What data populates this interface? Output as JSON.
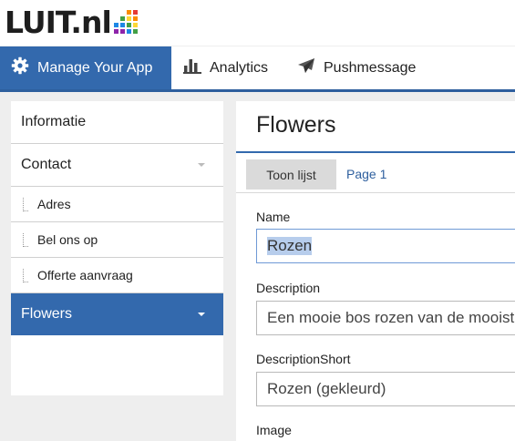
{
  "brand": {
    "logo_text": "LUIT.nl",
    "colors": {
      "primary": "#3369ad",
      "link": "#2e5f9e"
    },
    "equalizer_colors": [
      "#e53935",
      "#fb8c00",
      "#fdd835",
      "#43a047",
      "#1e88e5",
      "#8e24aa"
    ]
  },
  "nav": {
    "tabs": [
      {
        "label": "Manage Your App",
        "icon": "gear-icon",
        "active": true
      },
      {
        "label": "Analytics",
        "icon": "bar-chart-icon",
        "active": false
      },
      {
        "label": "Pushmessage",
        "icon": "paper-plane-icon",
        "active": false
      }
    ]
  },
  "sidebar": {
    "items": [
      {
        "label": "Informatie",
        "level": 1
      },
      {
        "label": "Contact",
        "level": 1,
        "has_dropdown": true
      },
      {
        "label": "Adres",
        "level": 2
      },
      {
        "label": "Bel ons op",
        "level": 2
      },
      {
        "label": "Offerte aanvraag",
        "level": 2
      },
      {
        "label": "Flowers",
        "level": 1,
        "active": true,
        "has_dropdown": true
      }
    ]
  },
  "main": {
    "title": "Flowers",
    "list_button": "Toon lijst",
    "page_link": "Page 1",
    "fields": [
      {
        "label": "Name",
        "value": "Rozen",
        "selected": true
      },
      {
        "label": "Description",
        "value": "Een mooie bos rozen van de mooiste"
      },
      {
        "label": "DescriptionShort",
        "value": "Rozen (gekleurd)"
      },
      {
        "label": "Image"
      }
    ]
  }
}
